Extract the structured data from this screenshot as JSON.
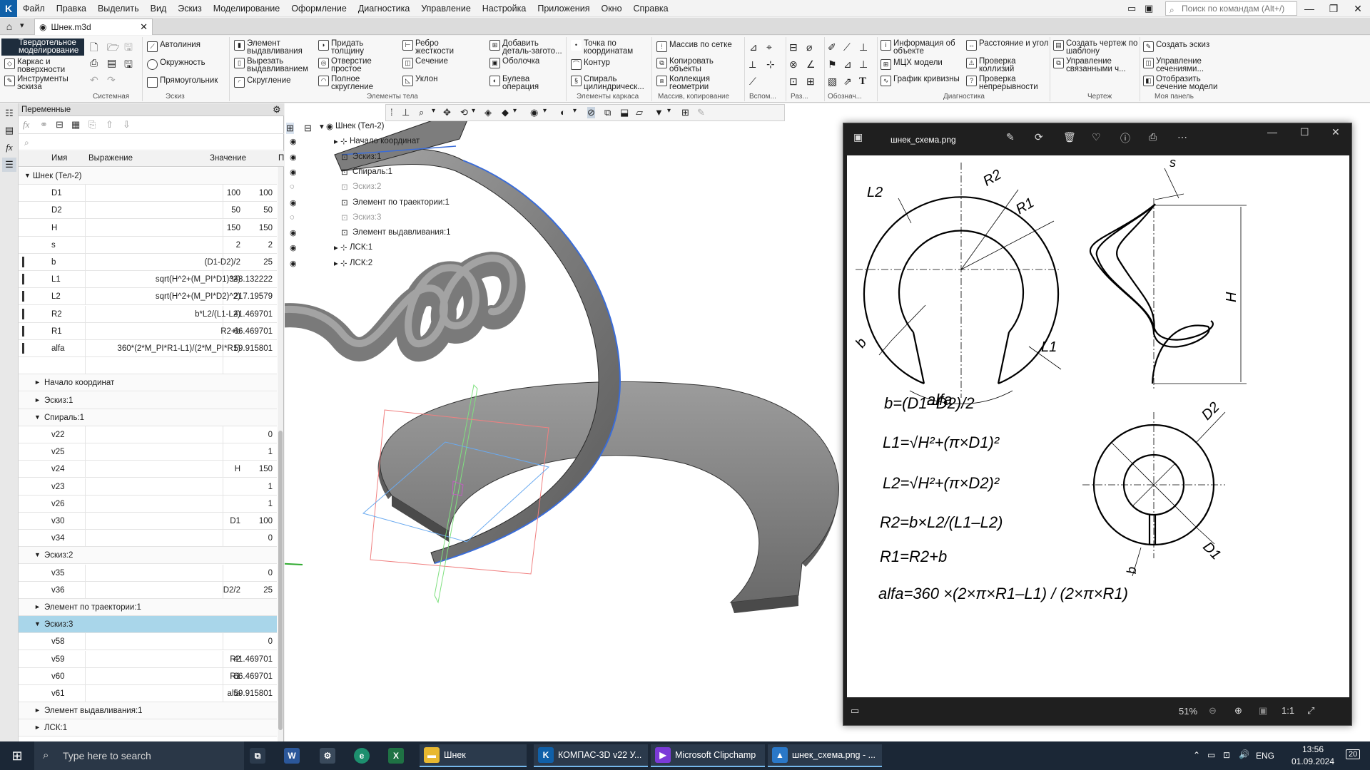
{
  "menu": [
    "Файл",
    "Правка",
    "Выделить",
    "Вид",
    "Эскиз",
    "Моделирование",
    "Оформление",
    "Диагностика",
    "Управление",
    "Настройка",
    "Приложения",
    "Окно",
    "Справка"
  ],
  "command_search_placeholder": "Поиск по командам (Alt+/)",
  "doc_tab": "Шнек.m3d",
  "ribbon": {
    "mode": "Твердотельное моделирование",
    "mode2": "Каркас и поверхности",
    "mode3": "Инструменты эскиза",
    "g_sketch": [
      "Автолиния",
      "Окружность",
      "Прямоугольник"
    ],
    "g_body1": [
      "Элемент выдавливания",
      "Вырезать выдавливанием",
      "Скругление"
    ],
    "g_body2": [
      "Придать толщину",
      "Отверстие простое",
      "Полное скругление"
    ],
    "g_body3": [
      "Ребро жесткости",
      "Сечение",
      "Уклон"
    ],
    "g_body4": [
      "Добавить деталь-загото...",
      "Оболочка",
      "Булева операция"
    ],
    "g_frame": [
      "Точка по координатам",
      "Контур",
      "Спираль цилиндрическ..."
    ],
    "g_array": [
      "Массив по сетке",
      "Копировать объекты",
      "Коллекция геометрии"
    ],
    "g_diag1": [
      "Информация об объекте",
      "МЦХ модели",
      "График кривизны"
    ],
    "g_diag2": [
      "Расстояние и угол",
      "Проверка коллизий",
      "Проверка непрерывности"
    ],
    "g_draw": [
      "Создать чертеж по шаблону",
      "Управление связанными ч..."
    ],
    "g_my": [
      "Создать эскиз",
      "Управление сечениями...",
      "Отобразить сечение модели"
    ],
    "labels": [
      "Системная",
      "Эскиз",
      "Элементы тела",
      "Элементы каркаса",
      "Массив, копирование",
      "Вспом...",
      "Раз...",
      "Обознач...",
      "Диагностика",
      "Чертеж",
      "Моя панель"
    ]
  },
  "vars_panel": {
    "title": "Переменные",
    "columns": [
      "Имя",
      "Выражение",
      "Значение",
      "П"
    ],
    "root": "Шнек (Тел-2)",
    "variables": [
      {
        "name": "D1",
        "expr": "100",
        "value": "100",
        "info": false
      },
      {
        "name": "D2",
        "expr": "50",
        "value": "50",
        "info": false
      },
      {
        "name": "H",
        "expr": "150",
        "value": "150",
        "info": false
      },
      {
        "name": "s",
        "expr": "2",
        "value": "2",
        "info": false
      },
      {
        "name": "b",
        "expr": "(D1-D2)/2",
        "value": "25",
        "info": true
      },
      {
        "name": "L1",
        "expr": "sqrt(H^2+(M_PI*D1)^2)",
        "value": "348.132222",
        "info": true
      },
      {
        "name": "L2",
        "expr": "sqrt(H^2+(M_PI*D2)^2)",
        "value": "217.19579",
        "info": true
      },
      {
        "name": "R2",
        "expr": "b*L2/(L1-L2)",
        "value": "41.469701",
        "info": true
      },
      {
        "name": "R1",
        "expr": "R2+b",
        "value": "66.469701",
        "info": true
      },
      {
        "name": "alfa",
        "expr": "360*(2*M_PI*R1-L1)/(2*M_PI*R1)",
        "value": "59.915801",
        "info": true
      }
    ],
    "groups": [
      {
        "name": "Начало координат",
        "open": false,
        "rows": []
      },
      {
        "name": "Эскиз:1",
        "open": false,
        "rows": []
      },
      {
        "name": "Спираль:1",
        "open": true,
        "rows": [
          {
            "name": "v22",
            "expr": "",
            "value": "0"
          },
          {
            "name": "v25",
            "expr": "",
            "value": "1"
          },
          {
            "name": "v24",
            "expr": "H",
            "value": "150"
          },
          {
            "name": "v23",
            "expr": "",
            "value": "1"
          },
          {
            "name": "v26",
            "expr": "",
            "value": "1"
          },
          {
            "name": "v30",
            "expr": "D1",
            "value": "100"
          },
          {
            "name": "v34",
            "expr": "",
            "value": "0"
          }
        ]
      },
      {
        "name": "Эскиз:2",
        "open": true,
        "rows": [
          {
            "name": "v35",
            "expr": "",
            "value": "0"
          },
          {
            "name": "v36",
            "expr": "D2/2",
            "value": "25"
          }
        ]
      },
      {
        "name": "Элемент по траектории:1",
        "open": false,
        "rows": []
      },
      {
        "name": "Эскиз:3",
        "open": true,
        "selected": true,
        "rows": [
          {
            "name": "v58",
            "expr": "",
            "value": "0"
          },
          {
            "name": "v59",
            "expr": "R2",
            "value": "41.469701"
          },
          {
            "name": "v60",
            "expr": "R1",
            "value": "66.469701"
          },
          {
            "name": "v61",
            "expr": "alfa",
            "value": "59.915801"
          }
        ]
      },
      {
        "name": "Элемент выдавливания:1",
        "open": false,
        "rows": []
      },
      {
        "name": "ЛСК:1",
        "open": false,
        "rows": []
      }
    ]
  },
  "tree": [
    {
      "label": "Шнек (Тел-2)",
      "eye": false,
      "dim": false,
      "x": 18
    },
    {
      "label": "Начало координат",
      "eye": true,
      "dim": false,
      "x": 38
    },
    {
      "label": "Эскиз:1",
      "eye": true,
      "dim": false,
      "x": 48
    },
    {
      "label": "Спираль:1",
      "eye": true,
      "dim": false,
      "x": 48
    },
    {
      "label": "Эскиз:2",
      "eye": "hidden",
      "dim": true,
      "x": 48
    },
    {
      "label": "Элемент по траектории:1",
      "eye": true,
      "dim": false,
      "x": 48
    },
    {
      "label": "Эскиз:3",
      "eye": "hidden",
      "dim": true,
      "x": 48
    },
    {
      "label": "Элемент выдавливания:1",
      "eye": true,
      "dim": false,
      "x": 48
    },
    {
      "label": "ЛСК:1",
      "eye": true,
      "dim": false,
      "x": 38
    },
    {
      "label": "ЛСК:2",
      "eye": true,
      "dim": false,
      "x": 38
    }
  ],
  "viewer": {
    "title": "шнек_схема.png",
    "zoom": "51%",
    "drawing": {
      "ring_labels": [
        "L2",
        "R2",
        "R1",
        "L1",
        "b",
        "alfa"
      ],
      "helix_labels": [
        "s",
        "H"
      ],
      "disk_labels": [
        "D2",
        "D1",
        "b"
      ],
      "formulas": [
        "b=(D1–D2)/2",
        "L1=√H²+(π×D1)²",
        "L2=√H²+(π×D2)²",
        "R2=b×L2/(L1–L2)",
        "R1=R2+b",
        "alfa=360 ×(2×π×R1–L1) / (2×π×R1)"
      ]
    }
  },
  "taskbar": {
    "search": "Type here to search",
    "apps": [
      "Шнек",
      "КОМПАС-3D v22 У...",
      "Microsoft Clipchamp",
      "шнек_схема.png - ..."
    ],
    "lang": "ENG",
    "time": "13:56",
    "date": "01.09.2024",
    "notif": "20"
  },
  "colors": {
    "selection": "#a9d6ea",
    "taskbar": "#1b2736",
    "mode_button": "#1e2d3d",
    "model_fill": "#8f8f8f",
    "model_edge": "#3a6cd8"
  }
}
